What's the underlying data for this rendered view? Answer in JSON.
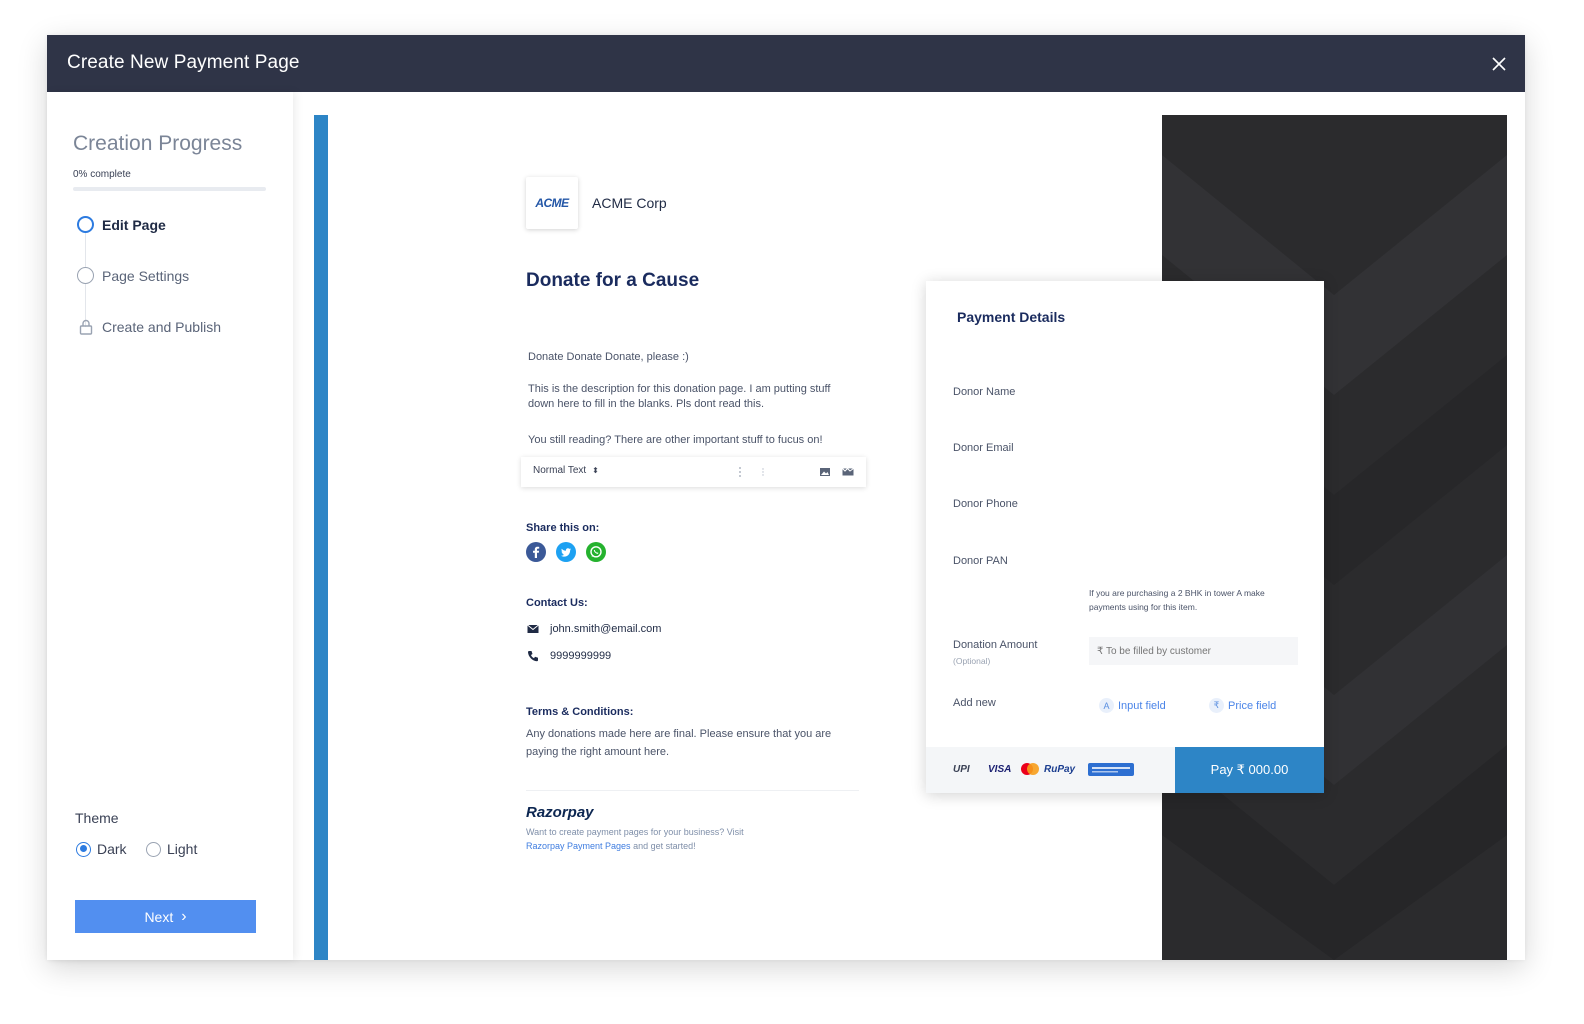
{
  "modal": {
    "title": "Create New Payment Page"
  },
  "sidebar": {
    "progress_title": "Creation Progress",
    "progress_pct_text": "0% complete",
    "progress_fraction": 0,
    "steps": [
      {
        "label": "Edit Page",
        "state": "active"
      },
      {
        "label": "Page Settings",
        "state": "pending"
      },
      {
        "label": "Create and Publish",
        "state": "locked"
      }
    ],
    "theme": {
      "title": "Theme",
      "options": [
        "Dark",
        "Light"
      ],
      "selected": "Dark"
    },
    "next_label": "Next"
  },
  "preview": {
    "brand": {
      "logo_text": "ACME",
      "name": "ACME Corp"
    },
    "heading": "Donate for a Cause",
    "desc": [
      "Donate Donate Donate, please :)",
      "This is the description for this donation page. I am putting stuff down here to fill in the blanks. Pls dont read this.",
      "You still reading? There are other important stuff to fucus on!"
    ],
    "toolbar": {
      "format": "Normal Text"
    },
    "share_title": "Share this on:",
    "social": [
      "facebook",
      "twitter",
      "whatsapp"
    ],
    "contact_title": "Contact Us:",
    "email": "john.smith@email.com",
    "phone": "9999999999",
    "terms_title": "Terms & Conditions:",
    "terms_text": "Any donations made here are final. Please ensure that you are paying the right amount here.",
    "razorpay": {
      "logo": "Razorpay",
      "note_pre": "Want to create payment pages for your business? Visit",
      "note_link": "Razorpay Payment Pages",
      "note_post": "and get started!"
    },
    "payment": {
      "title": "Payment Details",
      "fields": [
        "Donor Name",
        "Donor Email",
        "Donor Phone",
        "Donor PAN"
      ],
      "helper": "If you are purchasing a 2 BHK in tower A make payments using for this item.",
      "amount_label": "Donation Amount",
      "amount_sub": "(Optional)",
      "amount_placeholder": "₹ To be filled by customer",
      "add_new": "Add new",
      "input_field": "Input field",
      "price_field": "Price field",
      "methods": [
        "UPI",
        "VISA",
        "RuPay"
      ],
      "pay_button": "Pay  ₹ 000.00"
    }
  },
  "colors": {
    "header": "#2f3447",
    "accent": "#2d85c6",
    "next_button": "#528ff0",
    "dark_panel": "#2b2b2d"
  }
}
